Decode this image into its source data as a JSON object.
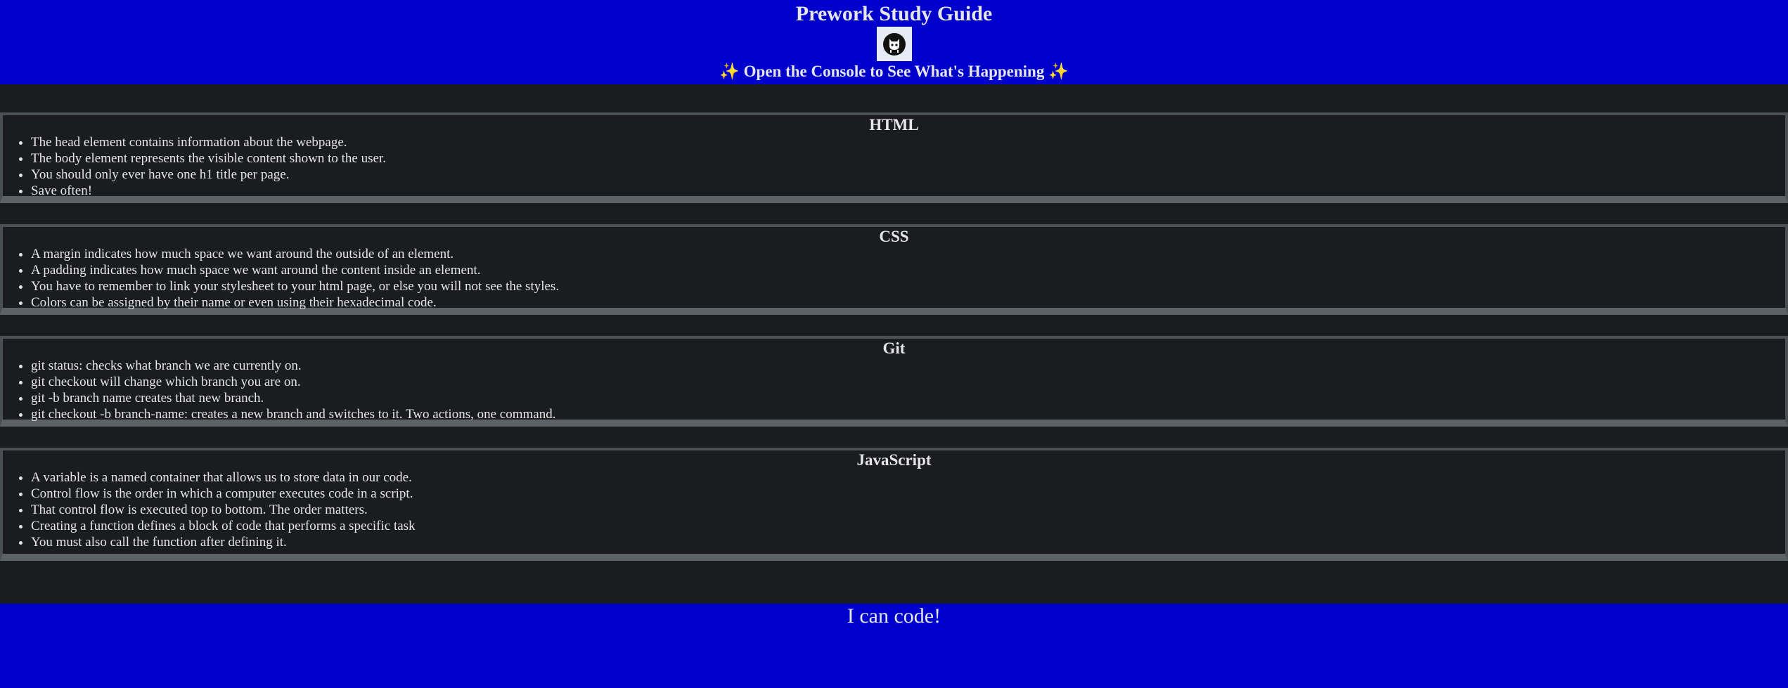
{
  "header": {
    "title": "Prework Study Guide",
    "logo_icon": "github-octocat-icon",
    "subtitle": "✨ Open the Console to See What's Happening ✨"
  },
  "sections": [
    {
      "title": "HTML",
      "items": [
        "The head element contains information about the webpage.",
        "The body element represents the visible content shown to the user.",
        "You should only ever have one h1 title per page.",
        "Save often!"
      ]
    },
    {
      "title": "CSS",
      "items": [
        "A margin indicates how much space we want around the outside of an element.",
        "A padding indicates how much space we want around the content inside an element.",
        "You have to remember to link your stylesheet to your html page, or else you will not see the styles.",
        "Colors can be assigned by their name or even using their hexadecimal code."
      ]
    },
    {
      "title": "Git",
      "items": [
        "git status: checks what branch we are currently on.",
        "git checkout will change which branch you are on.",
        "git -b branch name creates that new branch.",
        "git checkout -b branch-name: creates a new branch and switches to it. Two actions, one command."
      ]
    },
    {
      "title": "JavaScript",
      "items": [
        "A variable is a named container that allows us to store data in our code.",
        "Control flow is the order in which a computer executes code in a script.",
        "That control flow is executed top to bottom. The order matters.",
        "Creating a function defines a block of code that performs a specific task",
        "You must also call the function after defining it."
      ]
    }
  ],
  "footer": {
    "text": "I can code!"
  },
  "colors": {
    "header_bg": "#0000cc",
    "page_bg": "#1b1c1f",
    "text": "#e6e6e6",
    "section_border": "#4a5054"
  }
}
